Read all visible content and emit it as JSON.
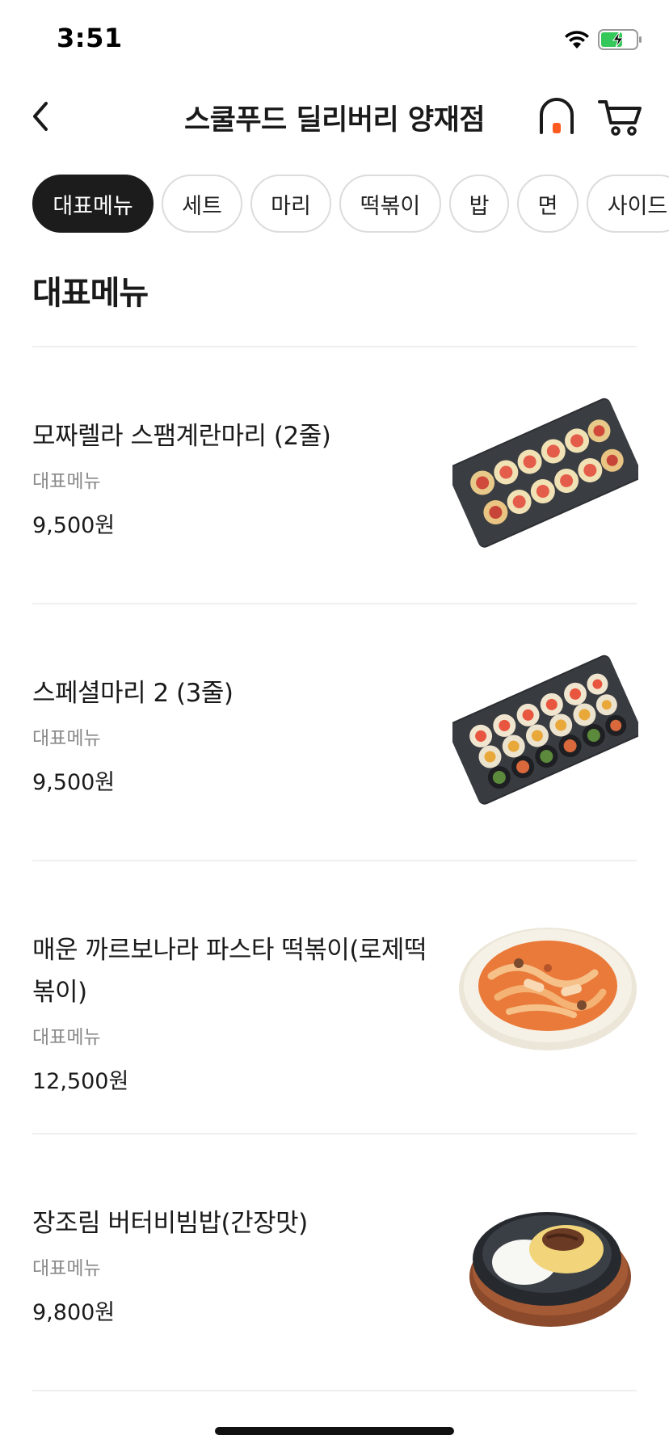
{
  "status_bar": {
    "time": "3:51"
  },
  "header": {
    "title": "스쿨푸드 딜리버리 양재점"
  },
  "categories": [
    {
      "label": "대표메뉴",
      "active": true
    },
    {
      "label": "세트"
    },
    {
      "label": "마리"
    },
    {
      "label": "떡볶이"
    },
    {
      "label": "밥"
    },
    {
      "label": "면"
    },
    {
      "label": "사이드"
    }
  ],
  "section_title": "대표메뉴",
  "items": [
    {
      "name": "모짜렐라 스팸계란마리 (2줄)",
      "category": "대표메뉴",
      "price": "9,500원",
      "image": "kimbap-platter-image"
    },
    {
      "name": "스페셜마리 2 (3줄)",
      "category": "대표메뉴",
      "price": "9,500원",
      "image": "kimbap-platter-image"
    },
    {
      "name_lines": [
        "매운 까르보나라 파스타 떡볶이(로제떡",
        "볶이)"
      ],
      "category": "대표메뉴",
      "price": "12,500원",
      "image": "rose-tteokbokki-image"
    },
    {
      "name": "장조림 버터비빔밥(간장맛)",
      "category": "대표메뉴",
      "price": "9,800원",
      "image": "bibimbap-image"
    }
  ]
}
